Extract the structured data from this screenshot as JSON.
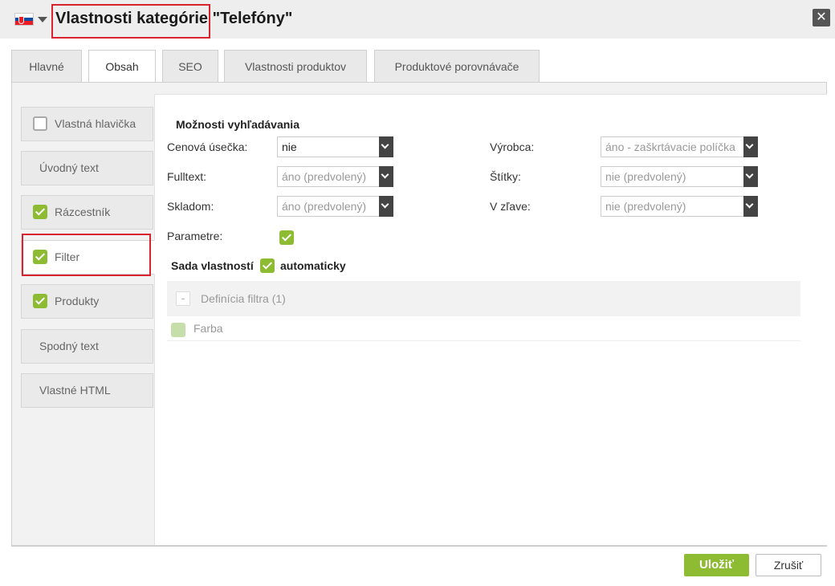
{
  "window": {
    "title": "Vlastnosti kategórie \"Telefóny\"",
    "close_label": "✕"
  },
  "tabs": [
    {
      "label": "Hlavné",
      "active": false
    },
    {
      "label": "Obsah",
      "active": true
    },
    {
      "label": "SEO",
      "active": false
    },
    {
      "label": "Vlastnosti produktov",
      "active": false
    },
    {
      "label": "Produktové porovnávače",
      "active": false
    }
  ],
  "sidebar": {
    "items": [
      {
        "label": "Vlastná hlavička",
        "checkbox": "off"
      },
      {
        "label": "Úvodný text",
        "checkbox": "none"
      },
      {
        "label": "Rázcestník",
        "checkbox": "on"
      },
      {
        "label": "Filter",
        "checkbox": "on",
        "active": true
      },
      {
        "label": "Produkty",
        "checkbox": "on"
      },
      {
        "label": "Spodný text",
        "checkbox": "none"
      },
      {
        "label": "Vlastné HTML",
        "checkbox": "none"
      }
    ]
  },
  "search_options": {
    "title": "Možnosti vyhľadávania",
    "fields": {
      "price": {
        "label": "Cenová úsečka:",
        "value": "nie"
      },
      "fulltext": {
        "label": "Fulltext:",
        "value": "áno (predvolený)"
      },
      "stock": {
        "label": "Skladom:",
        "value": "áno (predvolený)"
      },
      "manufacturer": {
        "label": "Výrobca:",
        "value": "áno - zaškrtávacie políčka"
      },
      "tags": {
        "label": "Štítky:",
        "value": "nie (predvolený)"
      },
      "sale": {
        "label": "V zľave:",
        "value": "nie (predvolený)"
      },
      "parameters": {
        "label": "Parametre:",
        "checked": true
      }
    }
  },
  "property_set": {
    "label": "Sada vlastností",
    "auto_label": "automaticky",
    "collapse_symbol": "-",
    "group_label": "Definícia filtra (1)",
    "items": [
      {
        "label": "Farba",
        "checked": true
      }
    ]
  },
  "footer": {
    "save_label": "Uložiť",
    "cancel_label": "Zrušiť"
  },
  "colors": {
    "accent_green": "#8dbb32",
    "highlight_red": "#d9232e"
  }
}
